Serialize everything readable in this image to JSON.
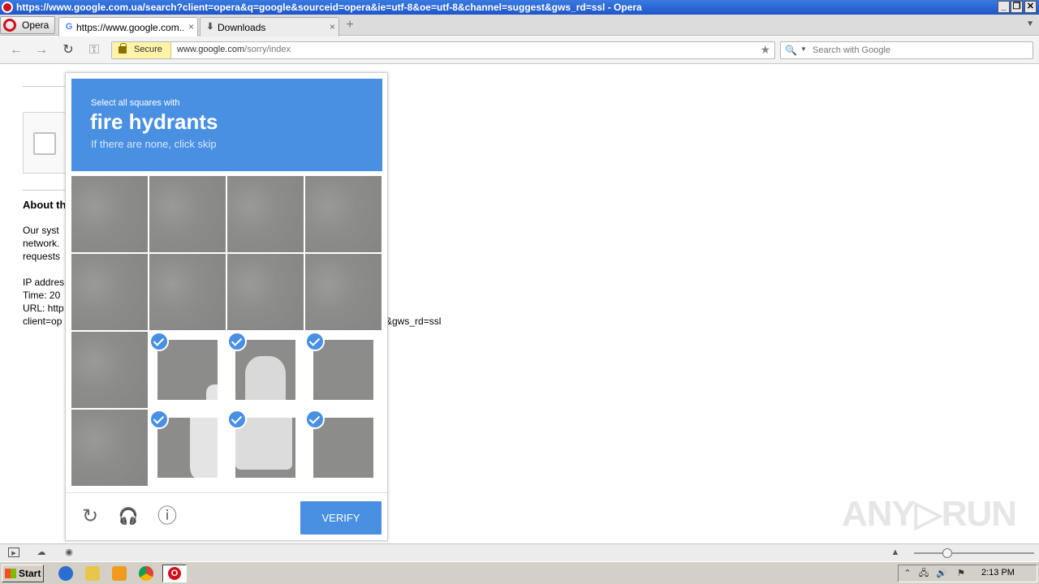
{
  "window": {
    "title": "https://www.google.com.ua/search?client=opera&q=google&sourceid=opera&ie=utf-8&oe=utf-8&channel=suggest&gws_rd=ssl - Opera",
    "minimize": "_",
    "restore": "❐",
    "close": "✕"
  },
  "tabs": {
    "menu_label": "Opera",
    "items": [
      {
        "label": "https://www.google.com...",
        "favicon": "G",
        "close": "×"
      },
      {
        "label": "Downloads",
        "favicon": "⬇",
        "close": "×"
      }
    ],
    "new_tab": "+"
  },
  "nav": {
    "back": "←",
    "forward": "→",
    "reload": "↻",
    "key": "⚿",
    "secure_label": "Secure",
    "url_host": "www.google.com",
    "url_path": "/sorry/index",
    "bookmark": "★",
    "search_placeholder": "Search with Google"
  },
  "page": {
    "about_heading": "About th",
    "lines": [
      "Our syst",
      "network.",
      "requests",
      "",
      "IP addres",
      "Time: 20",
      "URL: http",
      "client=op"
    ],
    "url_tail": "&gws_rd=ssl"
  },
  "captcha": {
    "instruction": "Select all squares with",
    "target": "fire hydrants",
    "hint": "If there are none, click skip",
    "tiles": [
      {
        "selected": false
      },
      {
        "selected": false
      },
      {
        "selected": false
      },
      {
        "selected": false
      },
      {
        "selected": false
      },
      {
        "selected": false
      },
      {
        "selected": false
      },
      {
        "selected": false
      },
      {
        "selected": false
      },
      {
        "selected": true
      },
      {
        "selected": true
      },
      {
        "selected": true
      },
      {
        "selected": false
      },
      {
        "selected": true
      },
      {
        "selected": true
      },
      {
        "selected": true
      }
    ],
    "verify_label": "VERIFY",
    "reload_icon": "↻",
    "audio_icon": "🎧",
    "info_icon": "ⓘ"
  },
  "watermark": "ANY▷RUN",
  "taskbar": {
    "start_label": "Start",
    "clock": "2:13 PM"
  },
  "colors": {
    "captcha_blue": "#4a90e2",
    "titlebar": "#1f56c8",
    "opera_red": "#d0101a"
  }
}
